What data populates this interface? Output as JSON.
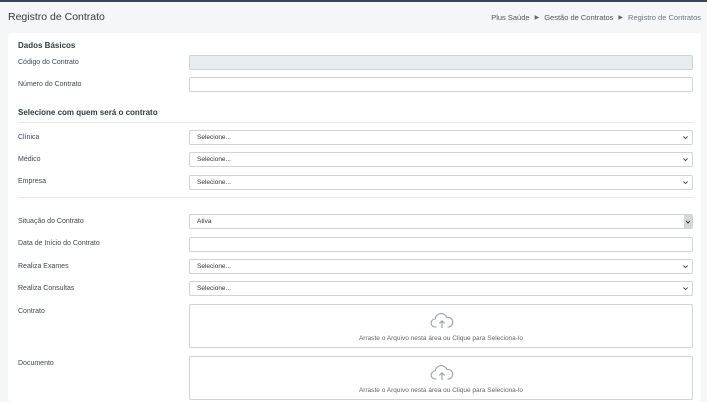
{
  "page": {
    "title": "Registro de Contrato",
    "breadcrumb": [
      "Plus Saúde",
      "Gestão de Contratos",
      "Registro de Contratos"
    ]
  },
  "form": {
    "sections": {
      "basic": "Dados Básicos",
      "select_with": "Selecione com quem será o contrato"
    },
    "labels": {
      "codigo": "Código do Contrato",
      "numero": "Número do Contrato",
      "clinica": "Clínica",
      "medico": "Médico",
      "empresa": "Empresa",
      "situacao": "Situação do Contrato",
      "data_inicio": "Data de Início do Contrato",
      "exames": "Realiza Exames",
      "consultas": "Realiza Consultas",
      "contrato": "Contrato",
      "documento": "Documento"
    },
    "values": {
      "codigo": "",
      "numero": "",
      "clinica": "Selecione...",
      "medico": "Selecione...",
      "empresa": "Selecione...",
      "situacao": "Ativa",
      "data_inicio": "",
      "exames": "Selecione...",
      "consultas": "Selecione..."
    },
    "dropzone_text": "Arraste o Arquivo nesta área ou Clique para Seleciona-lo"
  },
  "icons": {
    "breadcrumb_separator": "caret-right-icon",
    "select": "chevron-down-icon",
    "upload": "cloud-upload-icon"
  },
  "colors": {
    "top_bar": "#3d4656",
    "background": "#f5f6f8",
    "disabled_field": "#e9ecef"
  }
}
